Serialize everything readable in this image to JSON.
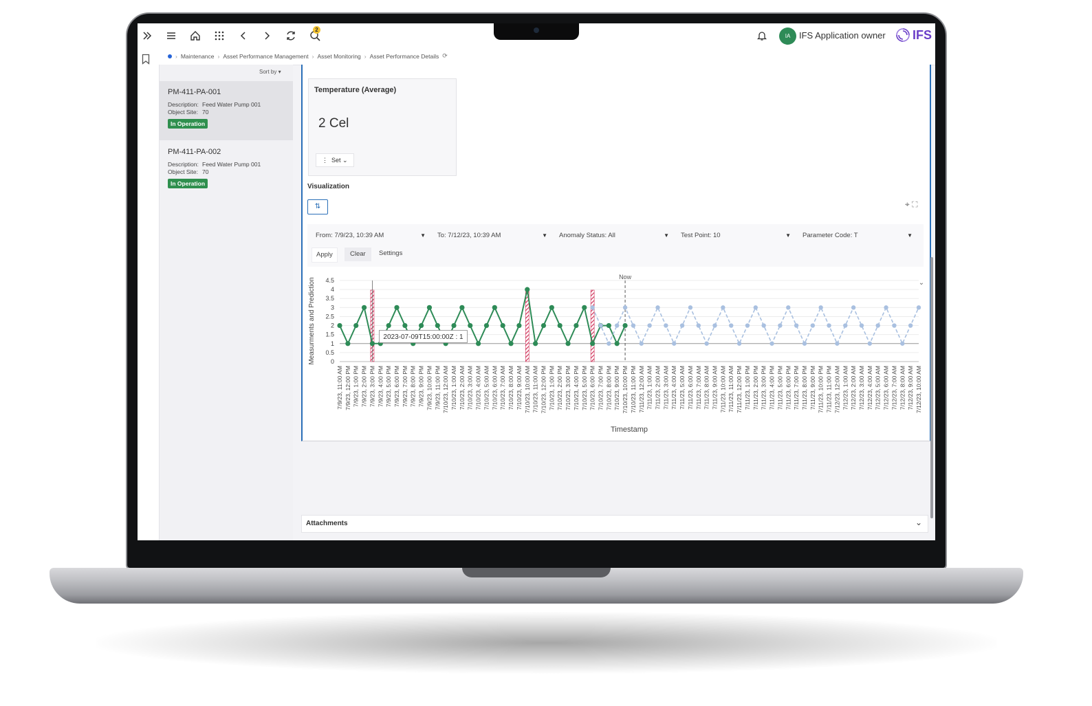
{
  "topbar": {
    "search_badge": "2",
    "user_initials": "IA",
    "user_name": "IFS Application owner",
    "logo": "IFS",
    "icons": [
      "expand-icon",
      "menu-icon",
      "home-icon",
      "apps-grid-icon",
      "back-icon",
      "forward-icon",
      "refresh-icon",
      "search-icon",
      "bell-icon"
    ]
  },
  "breadcrumb": {
    "items": [
      "Maintenance",
      "Asset Performance Management",
      "Asset Monitoring",
      "Asset Performance Details"
    ]
  },
  "list": {
    "sort_label": "Sort by",
    "items": [
      {
        "id": "PM-411-PA-001",
        "desc_label": "Description:",
        "desc": "Feed Water Pump 001",
        "site_label": "Object Site:",
        "site": "70",
        "status": "In Operation"
      },
      {
        "id": "PM-411-PA-002",
        "desc_label": "Description:",
        "desc": "Feed Water Pump 001",
        "site_label": "Object Site:",
        "site": "70",
        "status": "In Operation"
      }
    ]
  },
  "temp_card": {
    "title": "Temperature (Average)",
    "value": "2 Cel",
    "set_label": "Set"
  },
  "visualization": {
    "title": "Visualization",
    "filters": {
      "from": "From: 7/9/23, 10:39 AM",
      "to": "To: 7/12/23, 10:39 AM",
      "anomaly": "Anomaly Status: All",
      "test_point": "Test Point: 10",
      "parameter": "Parameter Code: T"
    },
    "apply_label": "Apply",
    "clear_label": "Clear",
    "settings_label": "Settings"
  },
  "attachments": {
    "label": "Attachments"
  },
  "colors": {
    "measure": "#2e8b57",
    "prediction": "#a9c0e0",
    "anomaly": "#d0335a",
    "accent": "#2a6fb8",
    "status": "#2f8f4e"
  },
  "chart_data": {
    "type": "line",
    "ylabel": "Measurments and Prediction",
    "xlabel": "Timestamp",
    "ylim": [
      0,
      4.5
    ],
    "yticks": [
      0,
      0.5,
      1,
      1.5,
      2,
      2.5,
      3,
      3.5,
      4,
      4.5
    ],
    "now_label": "Now",
    "now_index": 35,
    "tooltip": "2023-07-09T15:00:00Z : 1",
    "tooltip_index": 4,
    "anomaly_indices": [
      4,
      23,
      31
    ],
    "categories": [
      "7/9/23, 11:00 AM",
      "7/9/23, 12:00 PM",
      "7/9/23, 1:00 PM",
      "7/9/23, 2:00 PM",
      "7/9/23, 3:00 PM",
      "7/9/23, 4:00 PM",
      "7/9/23, 5:00 PM",
      "7/9/23, 6:00 PM",
      "7/9/23, 7:00 PM",
      "7/9/23, 8:00 PM",
      "7/9/23, 9:00 PM",
      "7/9/23, 10:00 PM",
      "7/9/23, 11:00 PM",
      "7/10/23, 12:00 AM",
      "7/10/23, 1:00 AM",
      "7/10/23, 2:00 AM",
      "7/10/23, 3:00 AM",
      "7/10/23, 4:00 AM",
      "7/10/23, 5:00 AM",
      "7/10/23, 6:00 AM",
      "7/10/23, 7:00 AM",
      "7/10/23, 8:00 AM",
      "7/10/23, 9:00 AM",
      "7/10/23, 10:00 AM",
      "7/10/23, 11:00 AM",
      "7/10/23, 12:00 PM",
      "7/10/23, 1:00 PM",
      "7/10/23, 2:00 PM",
      "7/10/23, 3:00 PM",
      "7/10/23, 4:00 PM",
      "7/10/23, 5:00 PM",
      "7/10/23, 6:00 PM",
      "7/10/23, 7:00 PM",
      "7/10/23, 8:00 PM",
      "7/10/23, 9:00 PM",
      "7/10/23, 10:00 PM",
      "7/10/23, 11:00 PM",
      "7/11/23, 12:00 AM",
      "7/11/23, 1:00 AM",
      "7/11/23, 2:00 AM",
      "7/11/23, 3:00 AM",
      "7/11/23, 4:00 AM",
      "7/11/23, 5:00 AM",
      "7/11/23, 6:00 AM",
      "7/11/23, 7:00 AM",
      "7/11/23, 8:00 AM",
      "7/11/23, 9:00 AM",
      "7/11/23, 10:00 AM",
      "7/11/23, 11:00 AM",
      "7/11/23, 12:00 PM",
      "7/11/23, 1:00 PM",
      "7/11/23, 2:00 PM",
      "7/11/23, 3:00 PM",
      "7/11/23, 4:00 PM",
      "7/11/23, 5:00 PM",
      "7/11/23, 6:00 PM",
      "7/11/23, 7:00 PM",
      "7/11/23, 8:00 PM",
      "7/11/23, 9:00 PM",
      "7/11/23, 10:00 PM",
      "7/11/23, 11:00 PM",
      "7/12/23, 12:00 AM",
      "7/12/23, 1:00 AM",
      "7/12/23, 2:00 AM",
      "7/12/23, 3:00 AM",
      "7/12/23, 4:00 AM",
      "7/12/23, 5:00 AM",
      "7/12/23, 6:00 AM",
      "7/12/23, 7:00 AM",
      "7/12/23, 8:00 AM",
      "7/12/23, 9:00 AM",
      "7/12/23, 10:00 AM"
    ],
    "series": [
      {
        "values": [
          2,
          1,
          2,
          3,
          1,
          1,
          2,
          3,
          2,
          1,
          2,
          3,
          2,
          1,
          2,
          3,
          2,
          1,
          2,
          3,
          2,
          1,
          2,
          4,
          1,
          2,
          3,
          2,
          1,
          2,
          3,
          1,
          2,
          2,
          1,
          2,
          null,
          null,
          null,
          null,
          null,
          null,
          null,
          null,
          null,
          null,
          null,
          null,
          null,
          null,
          null,
          null,
          null,
          null,
          null,
          null,
          null,
          null,
          null,
          null,
          null,
          null,
          null,
          null,
          null,
          null,
          null,
          null,
          null,
          null,
          null,
          null
        ]
      },
      {
        "values": [
          null,
          null,
          null,
          null,
          null,
          null,
          null,
          null,
          null,
          null,
          null,
          null,
          null,
          null,
          null,
          null,
          null,
          null,
          null,
          null,
          null,
          null,
          null,
          null,
          null,
          null,
          null,
          null,
          null,
          null,
          null,
          3,
          2,
          1,
          2,
          3,
          2,
          1,
          2,
          3,
          2,
          1,
          2,
          3,
          2,
          1,
          2,
          3,
          2,
          1,
          2,
          3,
          2,
          1,
          2,
          3,
          2,
          1,
          2,
          3,
          2,
          1,
          2,
          3,
          2,
          1,
          2,
          3,
          2,
          1,
          2,
          3
        ]
      }
    ]
  }
}
